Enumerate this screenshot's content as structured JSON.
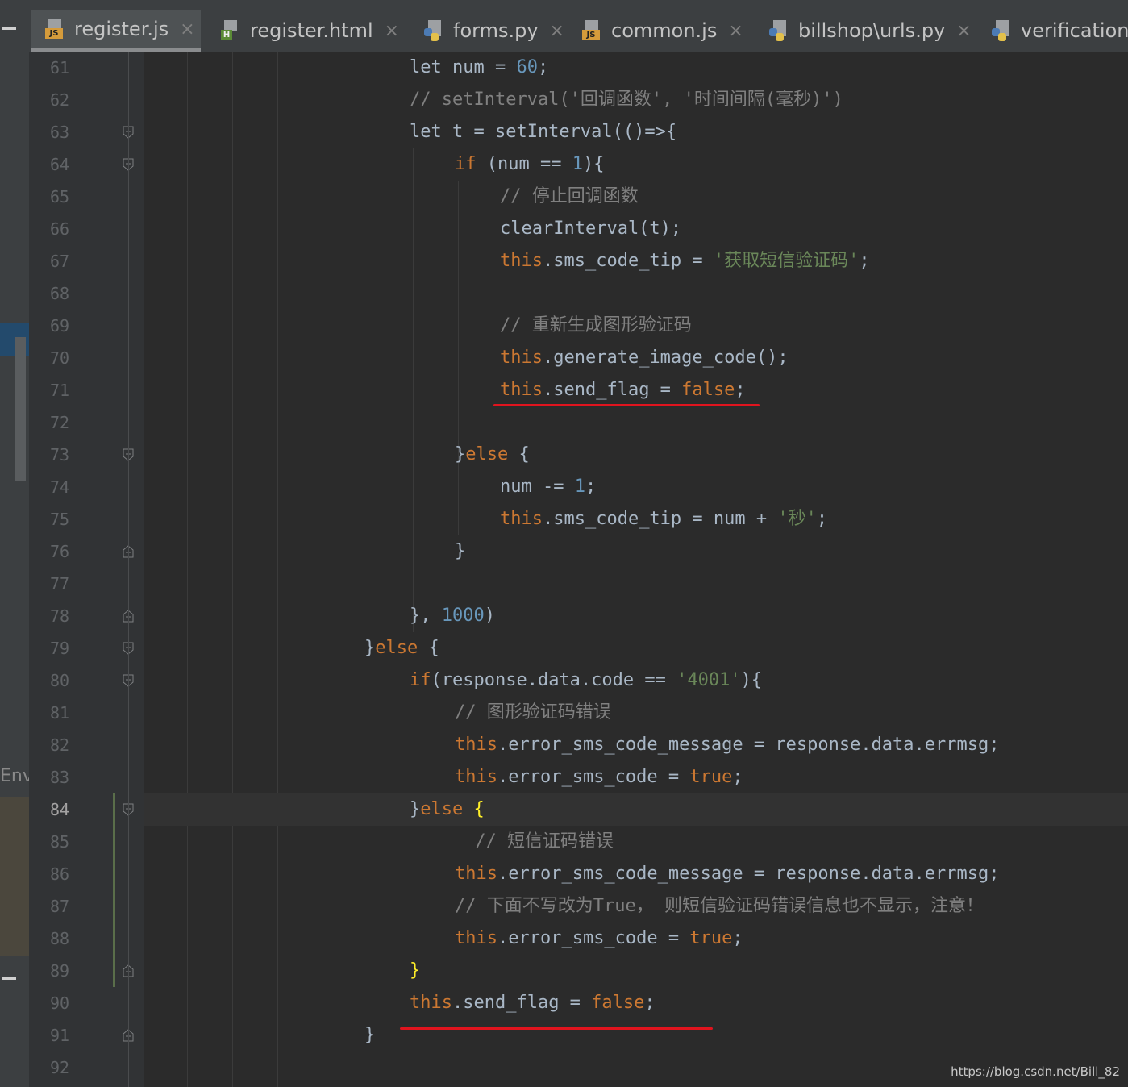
{
  "tabs": [
    {
      "label": "register.js",
      "icon": "js-file-icon",
      "active": true,
      "closable": true
    },
    {
      "label": "register.html",
      "icon": "html-file-icon",
      "active": false,
      "closable": true
    },
    {
      "label": "forms.py",
      "icon": "python-file-icon",
      "active": false,
      "closable": true
    },
    {
      "label": "common.js",
      "icon": "js-file-icon",
      "active": false,
      "closable": true
    },
    {
      "label": "billshop\\urls.py",
      "icon": "python-file-icon",
      "active": false,
      "closable": true
    },
    {
      "label": "verifications\\",
      "icon": "python-file-icon",
      "active": false,
      "closable": false
    }
  ],
  "close_glyph": "×",
  "side_panel_label": "Env",
  "current_line": "84",
  "line_numbers": [
    "61",
    "62",
    "63",
    "64",
    "65",
    "66",
    "67",
    "68",
    "69",
    "70",
    "71",
    "72",
    "73",
    "74",
    "75",
    "76",
    "77",
    "78",
    "79",
    "80",
    "81",
    "82",
    "83",
    "84",
    "85",
    "86",
    "87",
    "88",
    "89",
    "90",
    "91",
    "92"
  ],
  "code_lines": [
    [
      {
        "t": "let num = "
      },
      {
        "t": "60",
        "c": "num"
      },
      {
        "t": ";"
      }
    ],
    [
      {
        "t": "// setInterval('回调函数', '时间间隔(毫秒)')",
        "c": "cm"
      }
    ],
    [
      {
        "t": "let t = setInterval(()=>{"
      }
    ],
    [
      {
        "t": "if",
        "c": "kw"
      },
      {
        "t": " (num == "
      },
      {
        "t": "1",
        "c": "num"
      },
      {
        "t": "){"
      }
    ],
    [
      {
        "t": "// 停止回调函数",
        "c": "cm"
      }
    ],
    [
      {
        "t": "clearInterval(t);"
      }
    ],
    [
      {
        "t": "this",
        "c": "kw"
      },
      {
        "t": ".sms_code_tip = "
      },
      {
        "t": "'获取短信验证码'",
        "c": "str"
      },
      {
        "t": ";"
      }
    ],
    [],
    [
      {
        "t": "// 重新生成图形验证码",
        "c": "cm"
      }
    ],
    [
      {
        "t": "this",
        "c": "kw"
      },
      {
        "t": ".generate_image_code();"
      }
    ],
    [
      {
        "t": "this",
        "c": "kw"
      },
      {
        "t": ".send_flag = "
      },
      {
        "t": "false",
        "c": "kw"
      },
      {
        "t": ";"
      }
    ],
    [],
    [
      {
        "t": "}"
      },
      {
        "t": "else",
        "c": "kw"
      },
      {
        "t": " {"
      }
    ],
    [
      {
        "t": "num -= "
      },
      {
        "t": "1",
        "c": "num"
      },
      {
        "t": ";"
      }
    ],
    [
      {
        "t": "this",
        "c": "kw"
      },
      {
        "t": ".sms_code_tip = num + "
      },
      {
        "t": "'秒'",
        "c": "str"
      },
      {
        "t": ";"
      }
    ],
    [
      {
        "t": "}"
      }
    ],
    [],
    [
      {
        "t": "}, "
      },
      {
        "t": "1000",
        "c": "num"
      },
      {
        "t": ")"
      }
    ],
    [
      {
        "t": "}"
      },
      {
        "t": "else",
        "c": "kw"
      },
      {
        "t": " {"
      }
    ],
    [
      {
        "t": "if",
        "c": "kw"
      },
      {
        "t": "(response.data.code == "
      },
      {
        "t": "'4001'",
        "c": "str"
      },
      {
        "t": "){"
      }
    ],
    [
      {
        "t": "// 图形验证码错误",
        "c": "cm"
      }
    ],
    [
      {
        "t": "this",
        "c": "kw"
      },
      {
        "t": ".error_sms_code_message = response.data.errmsg;"
      }
    ],
    [
      {
        "t": "this",
        "c": "kw"
      },
      {
        "t": ".error_sms_code = "
      },
      {
        "t": "true",
        "c": "kw"
      },
      {
        "t": ";"
      }
    ],
    [
      {
        "t": "}"
      },
      {
        "t": "else",
        "c": "kw"
      },
      {
        "t": " "
      },
      {
        "t": "{",
        "c": "br"
      }
    ],
    [
      {
        "t": " // 短信证码错误",
        "c": "cm"
      }
    ],
    [
      {
        "t": "this",
        "c": "kw"
      },
      {
        "t": ".error_sms_code_message = response.data.errmsg;"
      }
    ],
    [
      {
        "t": "// 下面不写改为True， 则短信验证码错误信息也不显示，注意！",
        "c": "cm"
      }
    ],
    [
      {
        "t": "this",
        "c": "kw"
      },
      {
        "t": ".error_sms_code = "
      },
      {
        "t": "true",
        "c": "kw"
      },
      {
        "t": ";"
      }
    ],
    [
      {
        "t": "}",
        "c": "br"
      }
    ],
    [
      {
        "t": "this",
        "c": "kw"
      },
      {
        "t": ".send_flag = "
      },
      {
        "t": "false",
        "c": "kw"
      },
      {
        "t": ";"
      }
    ],
    [
      {
        "t": "}"
      }
    ],
    []
  ],
  "watermark": "https://blog.csdn.net/Bill_82",
  "colors": {
    "background": "#2b2b2b",
    "keyword": "#cc7832",
    "number": "#6897bb",
    "string": "#6a8759",
    "comment": "#808080",
    "default_text": "#a9b7c6",
    "matched_brace": "#ffef28",
    "annotation_underline": "#e0141e"
  }
}
